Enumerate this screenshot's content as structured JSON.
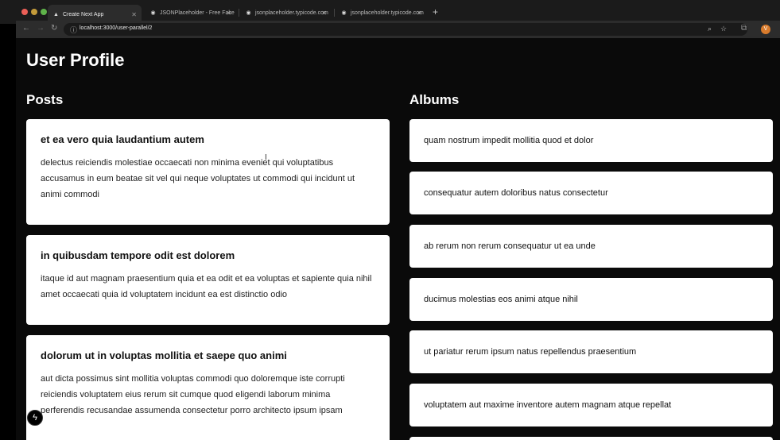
{
  "browser": {
    "tabs": [
      {
        "label": "Create Next App",
        "icon": "triangle-icon",
        "active": true
      },
      {
        "label": "JSONPlaceholder - Free Fake",
        "icon": "globe-icon",
        "active": false
      },
      {
        "label": "jsonplaceholder.typicode.com",
        "icon": "globe-icon",
        "active": false
      },
      {
        "label": "jsonplaceholder.typicode.com",
        "icon": "globe-icon",
        "active": false
      }
    ],
    "new_tab": "+",
    "url": "localhost:3000/user-parallel/2",
    "avatar_initial": "V"
  },
  "page": {
    "title": "User Profile",
    "posts_heading": "Posts",
    "albums_heading": "Albums",
    "posts": [
      {
        "title": "et ea vero quia laudantium autem",
        "body": "delectus reiciendis molestiae occaecati non minima eveniet qui voluptatibus accusamus in eum beatae sit vel qui neque voluptates ut commodi qui incidunt ut animi commodi"
      },
      {
        "title": "in quibusdam tempore odit est dolorem",
        "body": "itaque id aut magnam praesentium quia et ea odit et ea voluptas et sapiente quia nihil amet occaecati quia id voluptatem incidunt ea est distinctio odio"
      },
      {
        "title": "dolorum ut in voluptas mollitia et saepe quo animi",
        "body": "aut dicta possimus sint mollitia voluptas commodi quo doloremque iste corrupti reiciendis voluptatem eius rerum sit cumque quod eligendi laborum minima perferendis recusandae assumenda consectetur porro architecto ipsum ipsam"
      }
    ],
    "albums": [
      "quam nostrum impedit mollitia quod et dolor",
      "consequatur autem doloribus natus consectetur",
      "ab rerum non rerum consequatur ut ea unde",
      "ducimus molestias eos animi atque nihil",
      "ut pariatur rerum ipsum natus repellendus praesentium",
      "voluptatem aut maxime inventore autem magnam atque repellat"
    ]
  },
  "colors": {
    "page_background": "#0a0a0a",
    "card_background": "#ffffff",
    "chrome_background": "#2c2c2c"
  }
}
